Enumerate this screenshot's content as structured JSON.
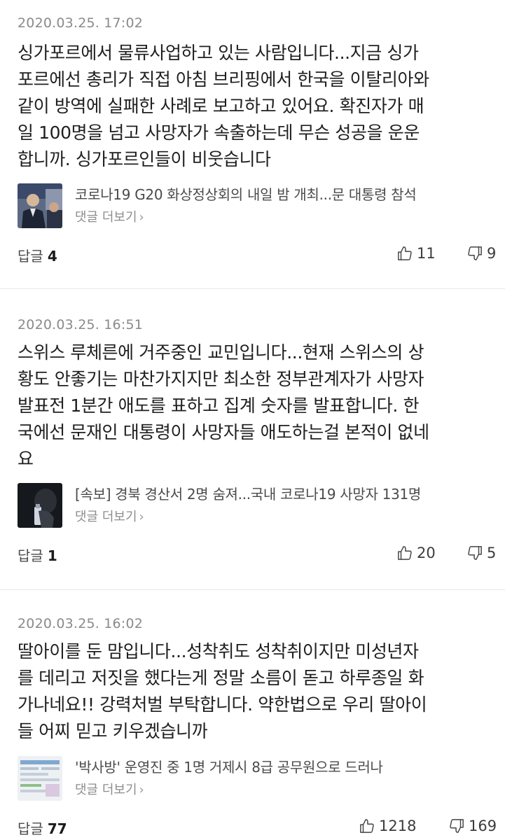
{
  "comments": [
    {
      "timestamp": "2020.03.25. 17:02",
      "text": "싱가포르에서 물류사업하고 있는 사람입니다...지금 싱가\n포르에선 총리가 직접 아침 브리핑에서 한국을 이탈리아와\n같이 방역에 실패한 사례로 보고하고 있어요. 확진자가 매\n일 100명을 넘고 사망자가 속출하는데 무슨 성공을 운운\n합니까. 싱가포르인들이 비웃습니다",
      "article_title": "코로나19 G20 화상정상회의 내일 밤 개최...문 대통령 참석",
      "more_comments": "댓글 더보기",
      "reply_label": "답글",
      "reply_count": "4",
      "likes": "11",
      "dislikes": "9"
    },
    {
      "timestamp": "2020.03.25. 16:51",
      "text": "스위스 루체른에 거주중인 교민입니다...현재 스위스의 상\n황도 안좋기는 마찬가지지만 최소한 정부관계자가 사망자\n발표전 1분간 애도를 표하고 집계 숫자를 발표합니다. 한\n국에선 문재인 대통령이 사망자들 애도하는걸 본적이 없네\n요",
      "article_title": "[속보] 경북 경산서 2명 숨져...국내 코로나19 사망자 131명",
      "more_comments": "댓글 더보기",
      "reply_label": "답글",
      "reply_count": "1",
      "likes": "20",
      "dislikes": "5"
    },
    {
      "timestamp": "2020.03.25. 16:02",
      "text": "딸아이를 둔 맘입니다...성착취도 성착취이지만 미성년자\n를 데리고 저짓을 했다는게 정말 소름이 돋고 하루종일 화\n가나네요!! 강력처벌 부탁합니다. 약한법으로 우리 딸아이\n들 어찌 믿고 키우겠습니까",
      "article_title": "'박사방' 운영진 중 1명 거제시 8급 공무원으로 드러나",
      "more_comments": "댓글 더보기",
      "reply_label": "답글",
      "reply_count": "77",
      "likes": "1218",
      "dislikes": "169"
    }
  ]
}
